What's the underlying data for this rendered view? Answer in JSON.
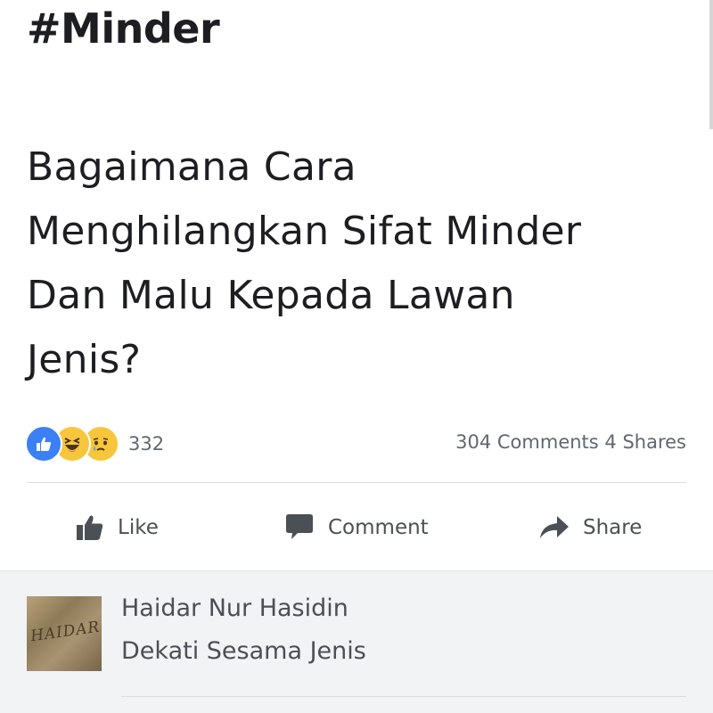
{
  "post": {
    "hashtag": "#Minder",
    "body_lines": [
      "Bagaimana Cara",
      "Menghilangkan Sifat Minder",
      "Dan Malu Kepada Lawan",
      "Jenis?"
    ]
  },
  "reactions": {
    "icons": [
      "like-reaction-icon",
      "haha-reaction-icon",
      "sad-reaction-icon"
    ],
    "count": "332"
  },
  "stats": {
    "comments": "304 Comments",
    "shares": "4 Shares"
  },
  "actions": {
    "like_label": "Like",
    "comment_label": "Comment",
    "share_label": "Share"
  },
  "comment": {
    "author": "Haidar Nur Hasidin",
    "text": "Dekati Sesama Jenis",
    "avatar_text": "HAIDAR"
  },
  "colors": {
    "like_blue": "#3b80f4",
    "emoji_yellow": "#f7c63a",
    "muted_text": "#606770",
    "comment_bg": "#f2f3f5"
  }
}
